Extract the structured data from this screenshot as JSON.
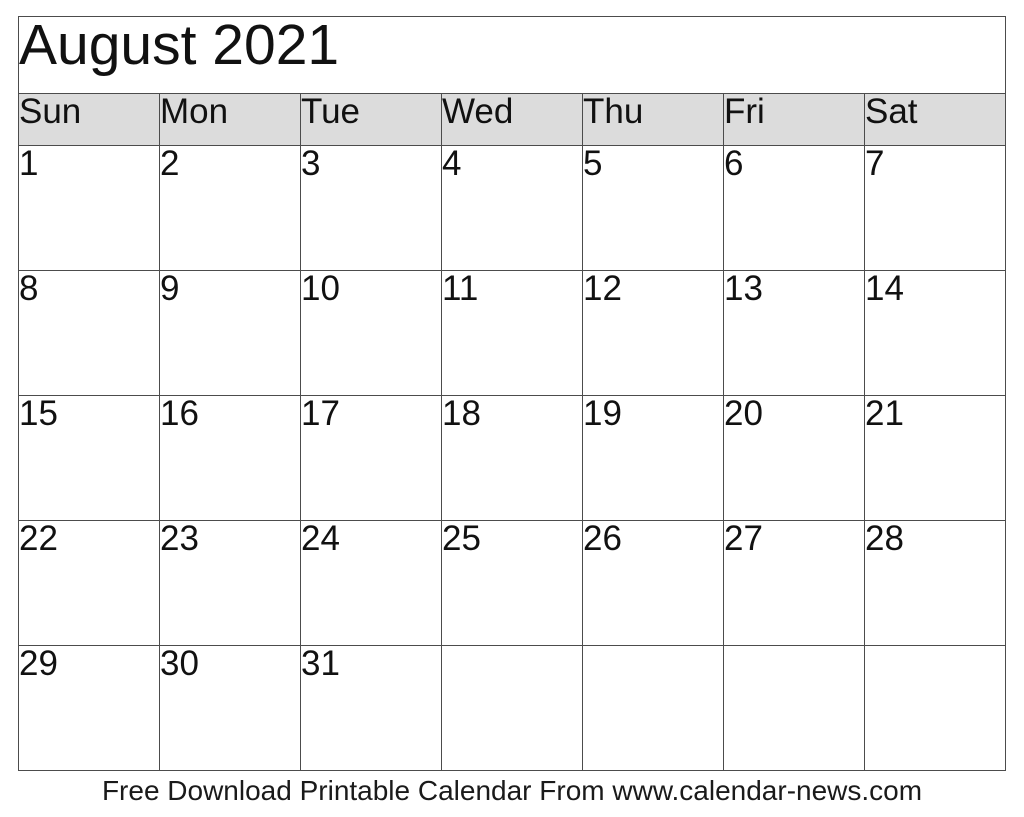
{
  "calendar": {
    "title": "August 2021",
    "month": "August",
    "year": "2021",
    "header_background": "#dcdcdc",
    "border_color": "#4c4c4c",
    "weekdays": [
      {
        "label": "Sun"
      },
      {
        "label": "Mon"
      },
      {
        "label": "Tue"
      },
      {
        "label": "Wed"
      },
      {
        "label": "Thu"
      },
      {
        "label": "Fri"
      },
      {
        "label": "Sat"
      }
    ],
    "weeks": [
      [
        {
          "day": "1",
          "empty": false
        },
        {
          "day": "2",
          "empty": false
        },
        {
          "day": "3",
          "empty": false
        },
        {
          "day": "4",
          "empty": false
        },
        {
          "day": "5",
          "empty": false
        },
        {
          "day": "6",
          "empty": false
        },
        {
          "day": "7",
          "empty": false
        }
      ],
      [
        {
          "day": "8",
          "empty": false
        },
        {
          "day": "9",
          "empty": false
        },
        {
          "day": "10",
          "empty": false
        },
        {
          "day": "11",
          "empty": false
        },
        {
          "day": "12",
          "empty": false
        },
        {
          "day": "13",
          "empty": false
        },
        {
          "day": "14",
          "empty": false
        }
      ],
      [
        {
          "day": "15",
          "empty": false
        },
        {
          "day": "16",
          "empty": false
        },
        {
          "day": "17",
          "empty": false
        },
        {
          "day": "18",
          "empty": false
        },
        {
          "day": "19",
          "empty": false
        },
        {
          "day": "20",
          "empty": false
        },
        {
          "day": "21",
          "empty": false
        }
      ],
      [
        {
          "day": "22",
          "empty": false
        },
        {
          "day": "23",
          "empty": false
        },
        {
          "day": "24",
          "empty": false
        },
        {
          "day": "25",
          "empty": false
        },
        {
          "day": "26",
          "empty": false
        },
        {
          "day": "27",
          "empty": false
        },
        {
          "day": "28",
          "empty": false
        }
      ],
      [
        {
          "day": "29",
          "empty": false
        },
        {
          "day": "30",
          "empty": false
        },
        {
          "day": "31",
          "empty": false
        },
        {
          "day": "",
          "empty": true
        },
        {
          "day": "",
          "empty": true
        },
        {
          "day": "",
          "empty": true
        },
        {
          "day": "",
          "empty": true
        }
      ]
    ]
  },
  "footer": {
    "text": "Free Download Printable Calendar From www.calendar-news.com"
  }
}
